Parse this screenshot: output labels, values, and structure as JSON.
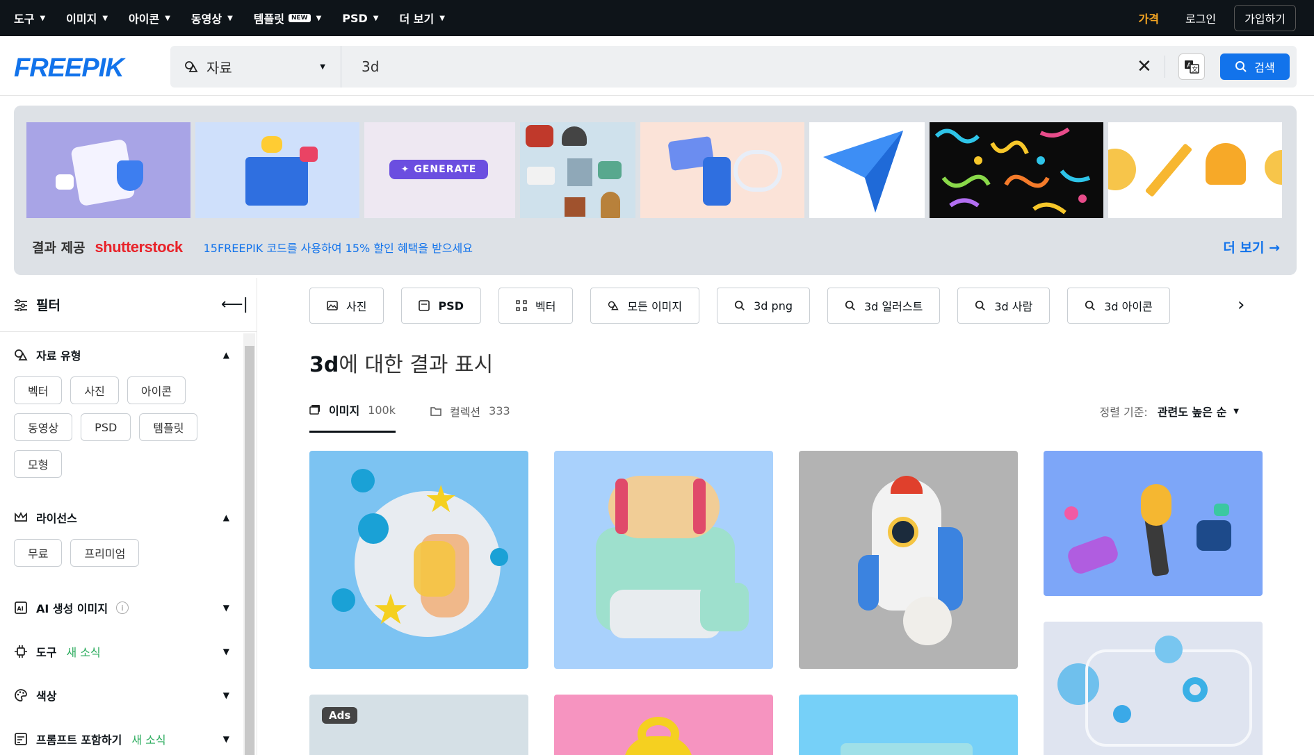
{
  "topnav": {
    "items": [
      {
        "label": "도구",
        "caret": true
      },
      {
        "label": "이미지",
        "caret": true
      },
      {
        "label": "아이콘",
        "caret": true
      },
      {
        "label": "동영상",
        "caret": true
      },
      {
        "label": "템플릿",
        "caret": true,
        "badge": "NEW"
      },
      {
        "label": "PSD",
        "caret": true
      },
      {
        "label": "더 보기",
        "caret": true
      }
    ],
    "price": "가격",
    "login": "로그인",
    "signup": "가입하기"
  },
  "header": {
    "logo": "FREEPIK",
    "type_select": "자료",
    "search_value": "3d",
    "search_button": "검색"
  },
  "banner": {
    "generate_label": "GENERATE",
    "provided_by": "결과 제공",
    "provider": "shutterstock",
    "promo": "15FREEPIK 코드를 사용하여 15% 할인 혜택을 받으세요",
    "more": "더 보기 →"
  },
  "sidebar": {
    "title": "필터",
    "asset_type": {
      "label": "자료 유형",
      "chips": [
        "벡터",
        "사진",
        "아이콘",
        "동영상",
        "PSD",
        "템플릿",
        "모형"
      ]
    },
    "license": {
      "label": "라이선스",
      "chips": [
        "무료",
        "프리미엄"
      ]
    },
    "ai": {
      "label": "AI 생성 이미지"
    },
    "tools": {
      "label": "도구",
      "new": "새 소식"
    },
    "color": {
      "label": "색상"
    },
    "prompt": {
      "label": "프롬프트 포함하기",
      "new": "새 소식"
    }
  },
  "main": {
    "related": [
      {
        "label": "사진",
        "icon": "photo-icon"
      },
      {
        "label": "PSD",
        "icon": "psd-icon"
      },
      {
        "label": "벡터",
        "icon": "vector-icon"
      },
      {
        "label": "모든 이미지",
        "icon": "assets-icon"
      },
      {
        "label": "3d png",
        "icon": "search-icon"
      },
      {
        "label": "3d 일러스트",
        "icon": "search-icon"
      },
      {
        "label": "3d 사람",
        "icon": "search-icon"
      },
      {
        "label": "3d 아이콘",
        "icon": "search-icon"
      }
    ],
    "results_term": "3d",
    "results_suffix": "에 대한 결과 표시",
    "tabs": [
      {
        "label": "이미지",
        "count": "100k"
      },
      {
        "label": "컬렉션",
        "count": "333"
      }
    ],
    "sort_label": "정렬 기준:",
    "sort_value": "관련도 높은 순",
    "ads_label": "Ads"
  }
}
